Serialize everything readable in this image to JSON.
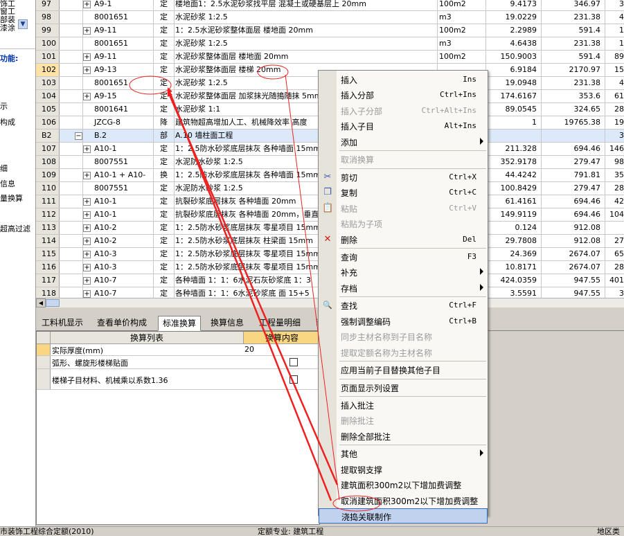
{
  "left_panel": {
    "items": [
      "饰工",
      "窗工",
      "部装",
      "漆涂",
      "功能:",
      "示",
      "构成",
      "细",
      "信息",
      "量换算",
      "超高过滤"
    ]
  },
  "grid": {
    "rows": [
      {
        "num": "97",
        "pm": "+",
        "code": "A9-1",
        "type": "定",
        "name": "楼地面1：2.5水泥砂浆找平层 混凝土或硬基层上 20mm",
        "unit": "100m2",
        "qty": "9.4173",
        "price": "346.97",
        "sum": "3"
      },
      {
        "num": "98",
        "pm": "",
        "code": "8001651",
        "type": "定",
        "name": "水泥砂浆 1:2.5",
        "unit": "m3",
        "qty": "19.0229",
        "price": "231.38",
        "sum": "4"
      },
      {
        "num": "99",
        "pm": "+",
        "code": "A9-11",
        "type": "定",
        "name": "1：2.5水泥砂浆整体面层 楼地面 20mm",
        "unit": "100m2",
        "qty": "2.2989",
        "price": "591.4",
        "sum": "1"
      },
      {
        "num": "100",
        "pm": "",
        "code": "8001651",
        "type": "定",
        "name": "水泥砂浆 1:2.5",
        "unit": "m3",
        "qty": "4.6438",
        "price": "231.38",
        "sum": "1"
      },
      {
        "num": "101",
        "pm": "+",
        "code": "A9-11",
        "type": "定",
        "name": "水泥砂浆整体面层 楼地面 20mm",
        "unit": "100m2",
        "qty": "150.9003",
        "price": "591.4",
        "sum": "89"
      },
      {
        "num": "102",
        "pm": "+",
        "code": "A9-13",
        "type": "定",
        "name": "水泥砂浆整体面层 楼梯 20mm",
        "unit": "",
        "qty": "6.9184",
        "price": "2170.97",
        "sum": "15",
        "sel": true
      },
      {
        "num": "103",
        "pm": "",
        "code": "8001651",
        "type": "定",
        "name": "水泥砂浆 1:2.5",
        "unit": "",
        "qty": "19.0948",
        "price": "231.38",
        "sum": "4"
      },
      {
        "num": "104",
        "pm": "+",
        "code": "A9-15",
        "type": "定",
        "name": "水泥砂浆整体面层 加浆抹光随搗随抹 5mm",
        "unit": "",
        "qty": "174.6167",
        "price": "353.6",
        "sum": "61"
      },
      {
        "num": "105",
        "pm": "",
        "code": "8001641",
        "type": "定",
        "name": "水泥砂浆 1:1",
        "unit": "",
        "qty": "89.0545",
        "price": "324.65",
        "sum": "28"
      },
      {
        "num": "106",
        "pm": "",
        "code": "JZCG-8",
        "type": "降",
        "name": "建筑物超高增加人工、机械降效率 高度",
        "unit": "",
        "qty": "1",
        "price": "19765.38",
        "sum": "19"
      },
      {
        "num": "B2",
        "pm": "−",
        "code": "B.2",
        "type": "部",
        "name": "A.10 墙柱面工程",
        "unit": "",
        "qty": "",
        "price": "",
        "sum": "3",
        "sec": true
      },
      {
        "num": "107",
        "pm": "+",
        "code": "A10-1",
        "type": "定",
        "name": "1：2.5防水砂浆底层抹灰 各种墙面 15mm",
        "unit": "",
        "qty": "211.328",
        "price": "694.46",
        "sum": "146"
      },
      {
        "num": "108",
        "pm": "",
        "code": "8007551",
        "type": "定",
        "name": "水泥防水砂浆 1:2.5",
        "unit": "",
        "qty": "352.9178",
        "price": "279.47",
        "sum": "98"
      },
      {
        "num": "109",
        "pm": "+",
        "code": "A10-1 + A10-",
        "type": "换",
        "name": "1：2.5防水砂浆底层抹灰 各种墙面 15mm",
        "unit": "",
        "qty": "44.4242",
        "price": "791.81",
        "sum": "35"
      },
      {
        "num": "110",
        "pm": "",
        "code": "8007551",
        "type": "定",
        "name": "水泥防水砂浆 1:2.5",
        "unit": "",
        "qty": "100.8429",
        "price": "279.47",
        "sum": "28"
      },
      {
        "num": "111",
        "pm": "+",
        "code": "A10-1",
        "type": "定",
        "name": "抗裂砂浆底层抹灰 各种墙面 20mm",
        "unit": "",
        "qty": "61.4161",
        "price": "694.46",
        "sum": "42"
      },
      {
        "num": "112",
        "pm": "+",
        "code": "A10-1",
        "type": "定",
        "name": "抗裂砂浆底层抹灰 各种墙面 20mm，垂直",
        "unit": "",
        "qty": "149.9119",
        "price": "694.46",
        "sum": "104"
      },
      {
        "num": "113",
        "pm": "+",
        "code": "A10-2",
        "type": "定",
        "name": "1：2.5防水砂浆底层抹灰 零星项目 15mm",
        "unit": "",
        "qty": "0.124",
        "price": "912.08",
        "sum": ""
      },
      {
        "num": "114",
        "pm": "+",
        "code": "A10-2",
        "type": "定",
        "name": "1：2.5防水砂浆底层抹灰 柱梁面 15mm",
        "unit": "",
        "qty": "29.7808",
        "price": "912.08",
        "sum": "27"
      },
      {
        "num": "115",
        "pm": "+",
        "code": "A10-3",
        "type": "定",
        "name": "1：2.5防水砂浆底层抹灰 零星项目 15mm",
        "unit": "",
        "qty": "24.369",
        "price": "2674.07",
        "sum": "65"
      },
      {
        "num": "116",
        "pm": "+",
        "code": "A10-3",
        "type": "定",
        "name": "1：2.5防水砂浆底层抹灰 零星项目 15mm",
        "unit": "",
        "qty": "10.8171",
        "price": "2674.07",
        "sum": "28"
      },
      {
        "num": "117",
        "pm": "+",
        "code": "A10-7",
        "type": "定",
        "name": "各种墙面 1：1：6水泥石灰砂浆底 1：3",
        "unit": "",
        "qty": "424.0359",
        "price": "947.55",
        "sum": "401"
      },
      {
        "num": "118",
        "pm": "+",
        "code": "A10-7",
        "type": "定",
        "name": "各种墙面 1：1：6水泥砂浆底 面 15+5",
        "unit": "",
        "qty": "3.5591",
        "price": "947.55",
        "sum": "3"
      }
    ]
  },
  "tabs": [
    "工料机显示",
    "查看单价构成",
    "标准换算",
    "换算信息",
    "工程量明细",
    "i"
  ],
  "active_tab": "标准换算",
  "bottom": {
    "header_list": "换算列表",
    "header_content": "换算内容",
    "rows": [
      {
        "label": "实际厚度(mm)",
        "value": "20"
      },
      {
        "label": "弧形、螺旋形楼梯贴面",
        "value": ""
      },
      {
        "label": "楼梯子目材料、机械乘以系数1.36",
        "value": ""
      }
    ]
  },
  "status": {
    "left": "市装饰工程综合定额(2010)",
    "middle": "定额专业: 建筑工程",
    "right": "地区类"
  },
  "menu": [
    {
      "label": "插入",
      "shortcut": "Ins",
      "disabled": false
    },
    {
      "label": "插入分部",
      "shortcut": "Ctrl+Ins",
      "disabled": false
    },
    {
      "label": "插入子分部",
      "shortcut": "Ctrl+Alt+Ins",
      "disabled": true
    },
    {
      "label": "插入子目",
      "shortcut": "Alt+Ins",
      "disabled": false
    },
    {
      "label": "添加",
      "shortcut": "",
      "disabled": false,
      "submenu": true
    },
    {
      "sep": true
    },
    {
      "label": "取消换算",
      "shortcut": "",
      "disabled": true
    },
    {
      "sep": true
    },
    {
      "label": "剪切",
      "shortcut": "Ctrl+X",
      "disabled": false,
      "icon": "cut-icon",
      "glyph": "✂"
    },
    {
      "label": "复制",
      "shortcut": "Ctrl+C",
      "disabled": false,
      "icon": "copy-icon",
      "glyph": "❐"
    },
    {
      "label": "粘贴",
      "shortcut": "Ctrl+V",
      "disabled": true,
      "icon": "paste-icon",
      "glyph": "📋"
    },
    {
      "label": "粘贴为子项",
      "shortcut": "",
      "disabled": true
    },
    {
      "label": "删除",
      "shortcut": "Del",
      "disabled": false,
      "icon": "delete-icon",
      "glyph": "✕"
    },
    {
      "sep": true
    },
    {
      "label": "查询",
      "shortcut": "F3",
      "disabled": false
    },
    {
      "label": "补充",
      "shortcut": "",
      "disabled": false,
      "submenu": true
    },
    {
      "label": "存档",
      "shortcut": "",
      "disabled": false,
      "submenu": true
    },
    {
      "sep": true
    },
    {
      "label": "查找",
      "shortcut": "Ctrl+F",
      "disabled": false,
      "icon": "find-icon",
      "glyph": "🔍"
    },
    {
      "label": "强制调整编码",
      "shortcut": "Ctrl+B",
      "disabled": false
    },
    {
      "label": "同步主材名称到子目名称",
      "shortcut": "",
      "disabled": true
    },
    {
      "label": "提取定额名称为主材名称",
      "shortcut": "",
      "disabled": true
    },
    {
      "sep": true
    },
    {
      "label": "应用当前子目替换其他子目",
      "shortcut": "",
      "disabled": false
    },
    {
      "sep": true
    },
    {
      "label": "页面显示列设置",
      "shortcut": "",
      "disabled": false
    },
    {
      "sep": true
    },
    {
      "label": "插入批注",
      "shortcut": "",
      "disabled": false
    },
    {
      "label": "删除批注",
      "shortcut": "",
      "disabled": true
    },
    {
      "label": "删除全部批注",
      "shortcut": "",
      "disabled": false
    },
    {
      "sep": true
    },
    {
      "label": "其他",
      "shortcut": "",
      "disabled": false,
      "submenu": true
    },
    {
      "label": "提取钢支撑",
      "shortcut": "",
      "disabled": false
    },
    {
      "label": "建筑面积300m2以下增加费调整",
      "shortcut": "",
      "disabled": false
    },
    {
      "label": "取消建筑面积300m2以下增加费调整",
      "shortcut": "",
      "disabled": false
    },
    {
      "label": "浇捣关联制作",
      "shortcut": "",
      "disabled": false,
      "highlight": true
    }
  ],
  "colors": {
    "menu_highlight": "#c1d2ee",
    "annotation_red": "#ee2020",
    "selected_row_num": "#ffe2a6",
    "section_row": "#dbe9f8"
  }
}
